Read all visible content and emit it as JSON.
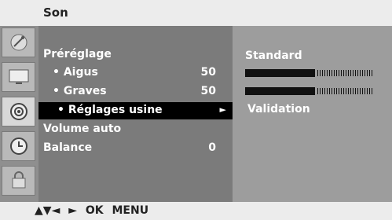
{
  "header": {
    "title": "Son"
  },
  "sidebar": {
    "items": [
      {
        "icon": "satellite-icon"
      },
      {
        "icon": "tv-screen-icon"
      },
      {
        "icon": "speaker-icon"
      },
      {
        "icon": "clock-icon"
      },
      {
        "icon": "lock-icon"
      }
    ],
    "active_index": 2
  },
  "menu": {
    "items": [
      {
        "label": "Préréglage",
        "value": ""
      },
      {
        "label": "• Aigus",
        "value": "50"
      },
      {
        "label": "• Graves",
        "value": "50"
      },
      {
        "label": "• Réglages usine",
        "value": "",
        "arrow": "►",
        "selected": true
      },
      {
        "label": "Volume auto",
        "value": ""
      },
      {
        "label": "Balance",
        "value": "0"
      }
    ]
  },
  "submenu": {
    "title": "Standard",
    "bars": [
      {
        "level_percent": 55
      },
      {
        "level_percent": 55
      }
    ],
    "validation": "Validation"
  },
  "footer": {
    "up_arrow": "▲",
    "down_arrow": "▼",
    "left_arrow": "◄",
    "right_arrow": "►",
    "ok": "OK",
    "menu": "MENU"
  }
}
